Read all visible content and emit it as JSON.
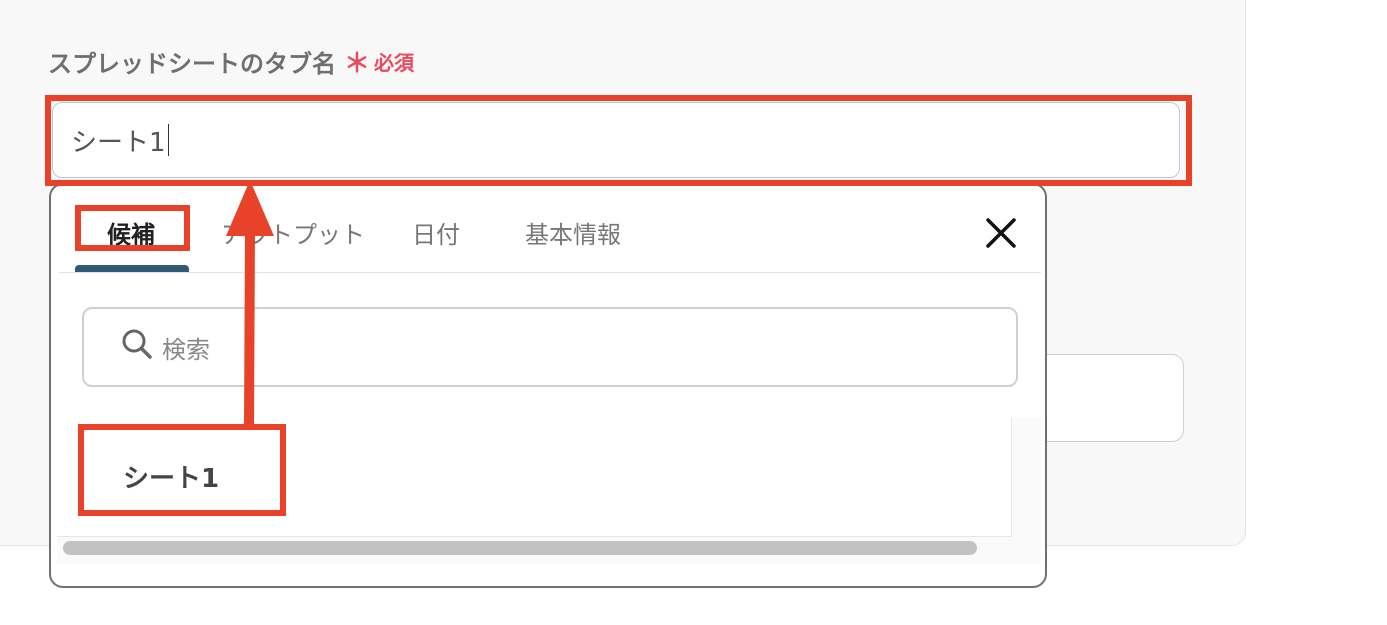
{
  "form": {
    "label": "スプレッドシートのタブ名",
    "required_mark": "＊",
    "required_text": "必須",
    "input_value": "シート1"
  },
  "dropdown": {
    "tabs": [
      {
        "label": "候補",
        "active": true
      },
      {
        "label": "アウトプット",
        "active": false
      },
      {
        "label": "日付",
        "active": false
      },
      {
        "label": "基本情報",
        "active": false
      }
    ],
    "close_icon": "close-icon",
    "search": {
      "placeholder": "検索",
      "icon": "search-icon"
    },
    "items": [
      {
        "label": "シート1"
      }
    ]
  },
  "colors": {
    "highlight": "#e8432a",
    "required": "#e84a5f",
    "tab_indicator": "#2f5b73"
  }
}
